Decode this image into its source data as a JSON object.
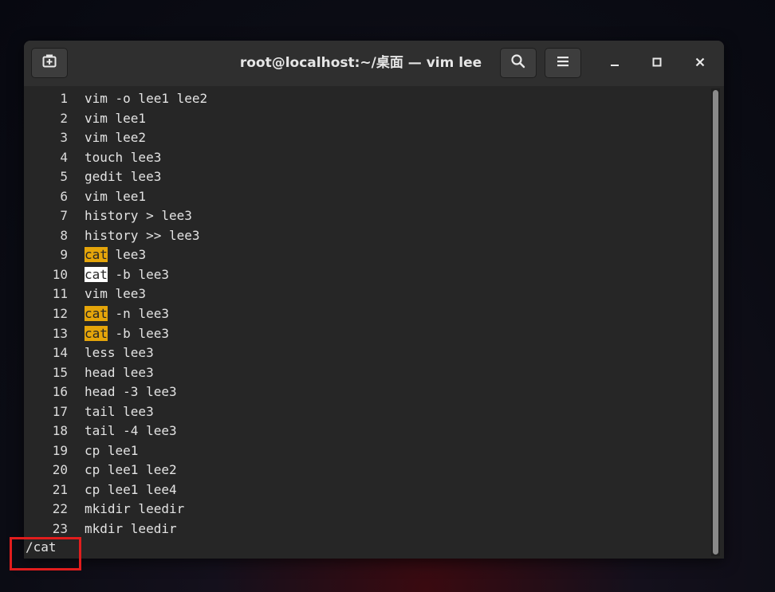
{
  "window": {
    "title": "root@localhost:~/桌面 — vim lee",
    "new_tab_icon": "new-tab-icon",
    "search_icon": "search-icon",
    "menu_icon": "hamburger-menu-icon",
    "minimize_icon": "minimize-icon",
    "maximize_icon": "maximize-icon",
    "close_icon": "close-icon"
  },
  "editor": {
    "lines": [
      {
        "num": "1",
        "pre": "",
        "match": "",
        "text": "vim -o lee1 lee2",
        "state": "none"
      },
      {
        "num": "2",
        "pre": "",
        "match": "",
        "text": "vim lee1",
        "state": "none"
      },
      {
        "num": "3",
        "pre": "",
        "match": "",
        "text": "vim lee2",
        "state": "none"
      },
      {
        "num": "4",
        "pre": "",
        "match": "",
        "text": "touch lee3",
        "state": "none"
      },
      {
        "num": "5",
        "pre": "",
        "match": "",
        "text": "gedit lee3",
        "state": "none"
      },
      {
        "num": "6",
        "pre": "",
        "match": "",
        "text": "vim lee1",
        "state": "none"
      },
      {
        "num": "7",
        "pre": "",
        "match": "",
        "text": "history > lee3",
        "state": "none"
      },
      {
        "num": "8",
        "pre": "",
        "match": "",
        "text": "history >> lee3",
        "state": "none"
      },
      {
        "num": "9",
        "pre": "",
        "match": "cat",
        "text": " lee3",
        "state": "match"
      },
      {
        "num": "10",
        "pre": "",
        "match": "cat",
        "text": " -b lee3",
        "state": "current"
      },
      {
        "num": "11",
        "pre": "",
        "match": "",
        "text": "vim lee3",
        "state": "none"
      },
      {
        "num": "12",
        "pre": "",
        "match": "cat",
        "text": " -n lee3",
        "state": "match"
      },
      {
        "num": "13",
        "pre": "",
        "match": "cat",
        "text": " -b lee3",
        "state": "match"
      },
      {
        "num": "14",
        "pre": "",
        "match": "",
        "text": "less lee3",
        "state": "none"
      },
      {
        "num": "15",
        "pre": "",
        "match": "",
        "text": "head lee3",
        "state": "none"
      },
      {
        "num": "16",
        "pre": "",
        "match": "",
        "text": "head -3 lee3",
        "state": "none"
      },
      {
        "num": "17",
        "pre": "",
        "match": "",
        "text": "tail lee3",
        "state": "none"
      },
      {
        "num": "18",
        "pre": "",
        "match": "",
        "text": "tail -4 lee3",
        "state": "none"
      },
      {
        "num": "19",
        "pre": "",
        "match": "",
        "text": "cp lee1",
        "state": "none"
      },
      {
        "num": "20",
        "pre": "",
        "match": "",
        "text": "cp lee1 lee2",
        "state": "none"
      },
      {
        "num": "21",
        "pre": "",
        "match": "",
        "text": "cp lee1 lee4",
        "state": "none"
      },
      {
        "num": "22",
        "pre": "",
        "match": "",
        "text": "mkidir leedir",
        "state": "none"
      },
      {
        "num": "23",
        "pre": "",
        "match": "",
        "text": "mkdir leedir",
        "state": "none"
      }
    ],
    "command_line": "/cat"
  },
  "colors": {
    "search_highlight": "#e5a50a",
    "current_match": "#ffffff",
    "annotation_box": "#e11d1d"
  }
}
